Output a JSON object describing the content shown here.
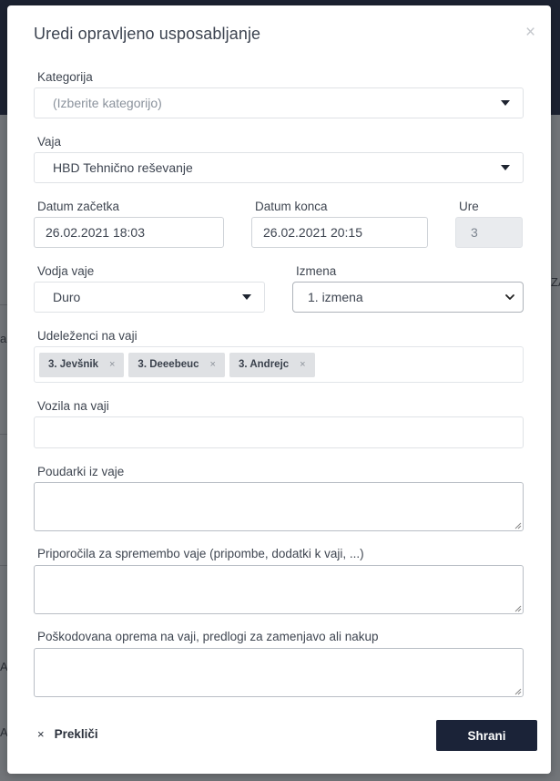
{
  "background": {
    "right_glimpse": "ZA",
    "left_glimpses": [
      "a",
      "A",
      "A"
    ]
  },
  "modal": {
    "title": "Uredi opravljeno usposabljanje",
    "close_symbol": "×",
    "category": {
      "label": "Kategorija",
      "placeholder": "(Izberite kategorijo)"
    },
    "exercise": {
      "label": "Vaja",
      "value": "HBD Tehnično reševanje"
    },
    "start_date": {
      "label": "Datum začetka",
      "value": "26.02.2021 18:03"
    },
    "end_date": {
      "label": "Datum konca",
      "value": "26.02.2021 20:15"
    },
    "hours": {
      "label": "Ure",
      "value": "3"
    },
    "leader": {
      "label": "Vodja vaje",
      "value": "Duro"
    },
    "shift": {
      "label": "Izmena",
      "value": "1. izmena"
    },
    "participants": {
      "label": "Udeleženci na vaji",
      "tags": [
        "3. Jevšnik",
        "3. Deeebeuc",
        "3. Andrejc"
      ],
      "remove_symbol": "×"
    },
    "vehicles": {
      "label": "Vozila na vaji"
    },
    "highlights": {
      "label": "Poudarki iz vaje"
    },
    "recommendations": {
      "label": "Priporočila za spremembo vaje (pripombe, dodatki k vaji, ...)"
    },
    "damaged_equipment": {
      "label": "Poškodovana oprema na vaji, predlogi za zamenjavo ali nakup"
    },
    "cancel": {
      "symbol": "×",
      "label": "Prekliči"
    },
    "save": {
      "label": "Shrani"
    }
  },
  "colors": {
    "primary_button": "#1b2338",
    "top_bar": "#1c2231",
    "overlay": "#727579"
  }
}
